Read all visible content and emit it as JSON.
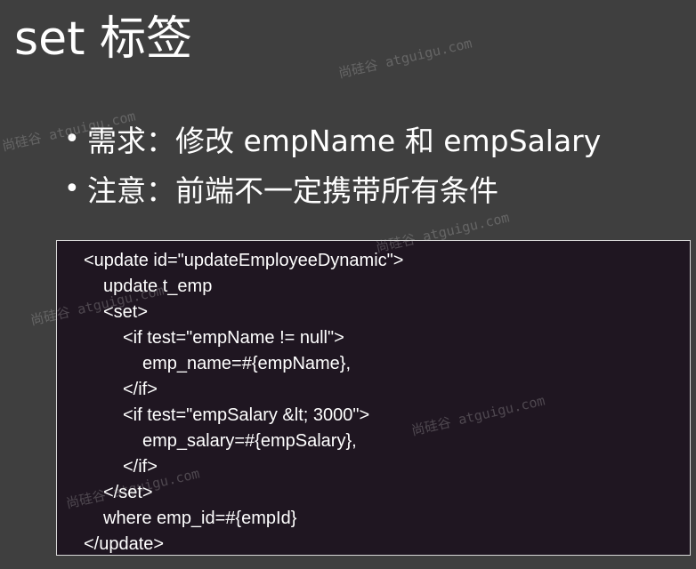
{
  "slide": {
    "title": "set 标签",
    "bullets": [
      "需求：修改 empName 和 empSalary",
      "注意：前端不一定携带所有条件"
    ],
    "bullet_glyph": "•"
  },
  "code": {
    "lines": [
      {
        "indent": 0,
        "text": "<update id=\"updateEmployeeDynamic\">"
      },
      {
        "indent": 1,
        "text": "update t_emp"
      },
      {
        "indent": 1,
        "text": "<set>"
      },
      {
        "indent": 2,
        "text": "<if test=\"empName != null\">"
      },
      {
        "indent": 3,
        "text": "emp_name=#{empName},"
      },
      {
        "indent": 2,
        "text": "</if>"
      },
      {
        "indent": 2,
        "text": "<if test=\"empSalary &lt; 3000\">"
      },
      {
        "indent": 3,
        "text": "emp_salary=#{empSalary},"
      },
      {
        "indent": 2,
        "text": "</if>"
      },
      {
        "indent": 1,
        "text": "</set>"
      },
      {
        "indent": 1,
        "text": "where emp_id=#{empId}"
      },
      {
        "indent": 0,
        "text": "</update>"
      }
    ]
  },
  "watermark": {
    "text": "尚硅谷 atguigu.com"
  },
  "colors": {
    "background": "#3f3f3f",
    "code_background": "#1f1621",
    "text": "#ffffff"
  }
}
